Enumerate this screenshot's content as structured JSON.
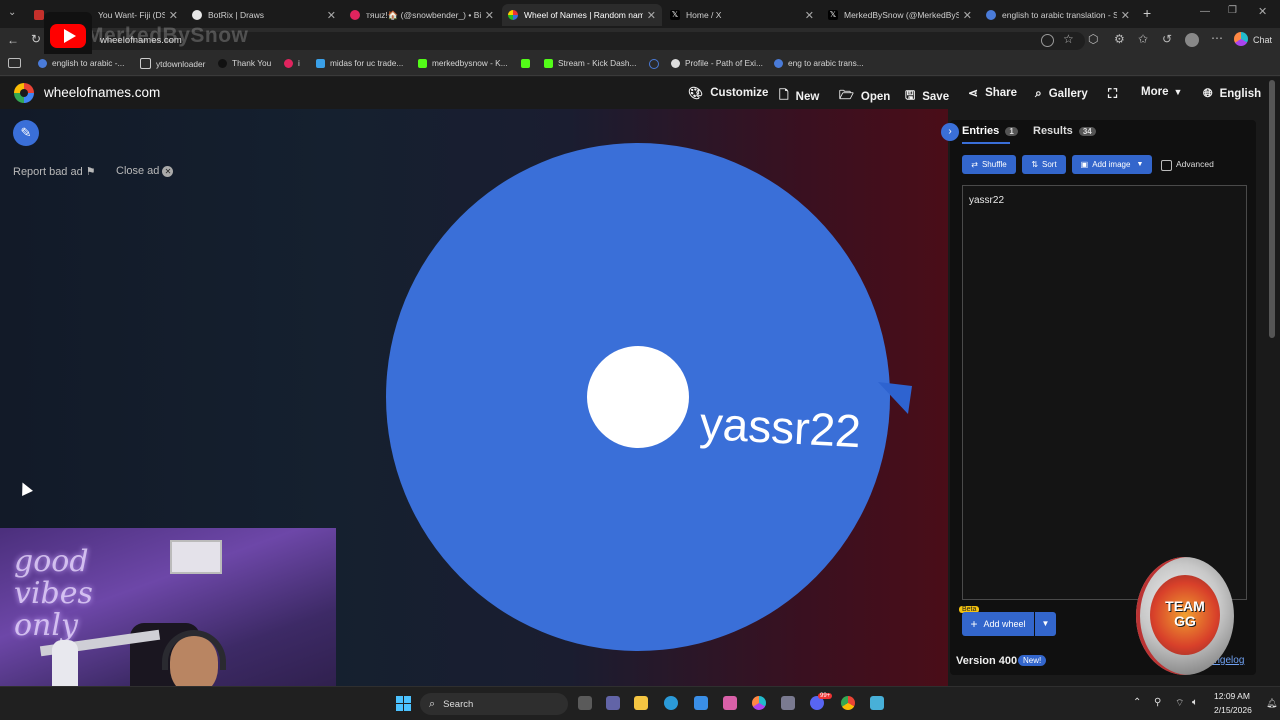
{
  "browser": {
    "tabs": [
      {
        "label": "You Want- Fiji (DSP)"
      },
      {
        "label": "BotRix | Draws"
      },
      {
        "label": "тяuιz!🏠 (@snowbender_) • Bi"
      },
      {
        "label": "Wheel of Names | Random name"
      },
      {
        "label": "Home / X"
      },
      {
        "label": "MerkedBySnow (@MerkedBySnow"
      },
      {
        "label": "english to arabic translation - Sea"
      }
    ],
    "url": "wheelofnames.com",
    "chat_label": "Chat",
    "bookmarks": [
      {
        "label": "english to arabic -..."
      },
      {
        "label": "ytdownloader"
      },
      {
        "label": "Thank You"
      },
      {
        "label": "i"
      },
      {
        "label": "midas for uc trade..."
      },
      {
        "label": "merkedbysnow - K..."
      },
      {
        "label": "Stream - Kick Dash..."
      },
      {
        "label": "Profile - Path of Exi..."
      },
      {
        "label": "eng to arabic trans..."
      }
    ]
  },
  "overlay": {
    "watermark": "MerkedBySnow"
  },
  "site": {
    "name": "wheelofnames.com",
    "nav": {
      "customize": "Customize",
      "new": "New",
      "open": "Open",
      "save": "Save",
      "share": "Share",
      "gallery": "Gallery",
      "more": "More",
      "language": "English"
    }
  },
  "ad": {
    "report": "Report bad ad",
    "close": "Close ad"
  },
  "wheel": {
    "entry": "yassr22",
    "color": "#3a6fd8"
  },
  "panel": {
    "tab_entries": "Entries",
    "entries_count": "1",
    "tab_results": "Results",
    "results_count": "34",
    "shuffle": "Shuffle",
    "sort": "Sort",
    "add_image": "Add image",
    "advanced": "Advanced",
    "entries_text": "yassr22",
    "beta": "Beta",
    "add_wheel": "Add wheel",
    "version": "Version 400",
    "new_badge": "New!",
    "changelog": "Changelog"
  },
  "stream": {
    "neon_text": "good vibes only",
    "coin_text": "TEAM GG"
  },
  "taskbar": {
    "search": "Search",
    "time": "12:09 AM",
    "date": "2/15/2026",
    "notif_count": "99+"
  }
}
